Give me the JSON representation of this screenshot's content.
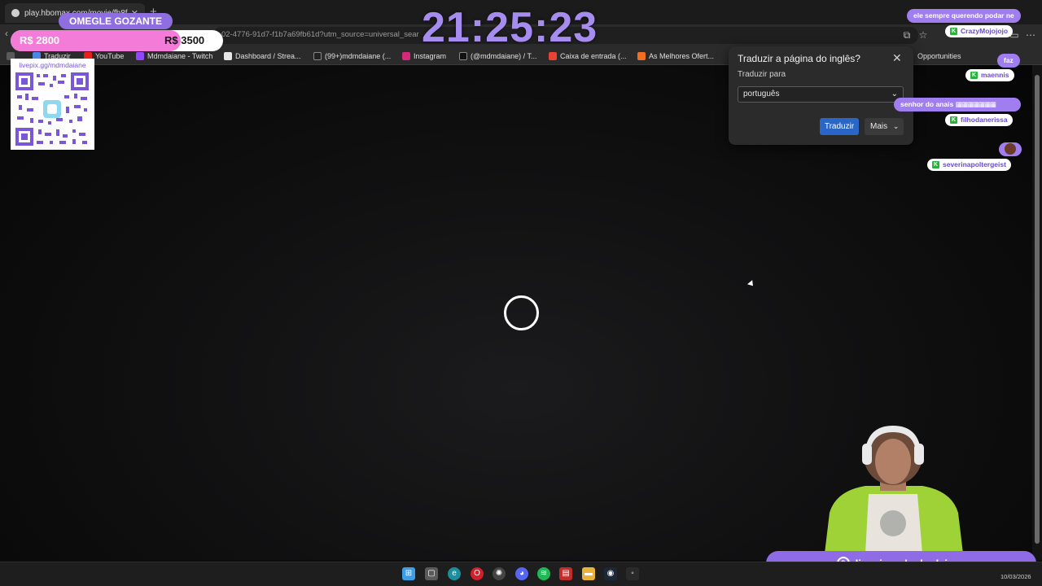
{
  "browser": {
    "tab_title": "play.hbomax.com/movie/fb8f961...",
    "url": "02-4776-91d7-f1b7a69fb61d?utm_source=universal_sear",
    "bookmarks": [
      {
        "label": "Traduzir",
        "color": "#4a86e8"
      },
      {
        "label": "YouTube",
        "color": "#e62117"
      },
      {
        "label": "Mdmdaiane - Twitch",
        "color": "#9146ff"
      },
      {
        "label": "Dashboard / Strea...",
        "color": "#e6e6e6"
      },
      {
        "label": "(99+)mdmdaiane (...",
        "color": "#222222"
      },
      {
        "label": "Instagram",
        "color": "#d6297a"
      },
      {
        "label": "(@mdmdaiane) / T...",
        "color": "#111111"
      },
      {
        "label": "Caixa de entrada (...",
        "color": "#ea4335"
      },
      {
        "label": "As Melhores Ofert...",
        "color": "#f26f21"
      },
      {
        "label": "Opportunities",
        "color": "#2b2b2b"
      }
    ]
  },
  "translate_popup": {
    "title": "Traduzir a página do inglês?",
    "label": "Traduzir para",
    "language": "português",
    "translate_button": "Traduzir",
    "more_button": "Mais"
  },
  "overlay": {
    "donation_title": "OMEGLE GOZANTE",
    "donation_current": "R$ 2800",
    "donation_goal": "R$ 3500",
    "donation_progress": 0.8,
    "qr_caption": "livepix.gg/mdmdaiane",
    "clock": "21:25:23",
    "livepix_label": "livepix.gg/mdmdaiane"
  },
  "chat": {
    "message1": "ele sempre querendo podar ne",
    "user1": "CrazyMojojojo",
    "message2": "faz",
    "user2": "maennis",
    "message3": "senhor do anais",
    "user3": "filhodanerissa",
    "user4": "severinapoltergeist"
  },
  "taskbar": {
    "date": "10/03/2026"
  },
  "colors": {
    "accent_purple": "#8f6be6",
    "clock_purple": "#a78cf0",
    "donation_pink": "#f27cd7",
    "translate_blue": "#2a66c8"
  }
}
